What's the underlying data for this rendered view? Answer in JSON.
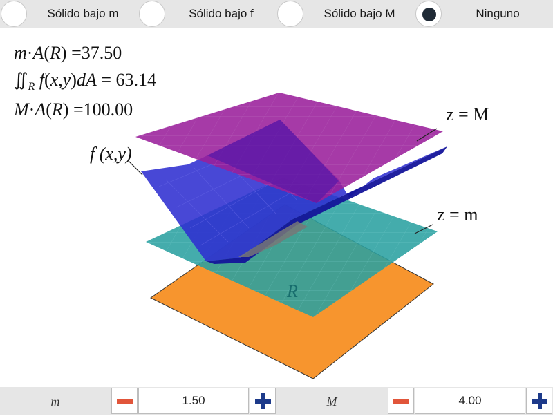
{
  "options": [
    {
      "label": "Sólido bajo m",
      "selected": false
    },
    {
      "label": "Sólido bajo f",
      "selected": false
    },
    {
      "label": "Sólido bajo M",
      "selected": false
    },
    {
      "label": "Ninguno",
      "selected": true
    }
  ],
  "formulas": {
    "m_times_area": "37.50",
    "integral": "63.14",
    "M_times_area": "100.00"
  },
  "scene_labels": {
    "z_M": "z = M",
    "z_m": "z = m",
    "f_label": "f (x,y)",
    "region": "R"
  },
  "params": {
    "m": {
      "label": "m",
      "value": "1.50"
    },
    "M": {
      "label": "M",
      "value": "4.00"
    }
  },
  "colors": {
    "plane_M": "#9a1f9b",
    "plane_m": "#2aa0a0",
    "surface_f": "#2f2fd0",
    "region_R": "#f7952e",
    "minus": "#e1553a",
    "plus": "#1d3a8a"
  }
}
